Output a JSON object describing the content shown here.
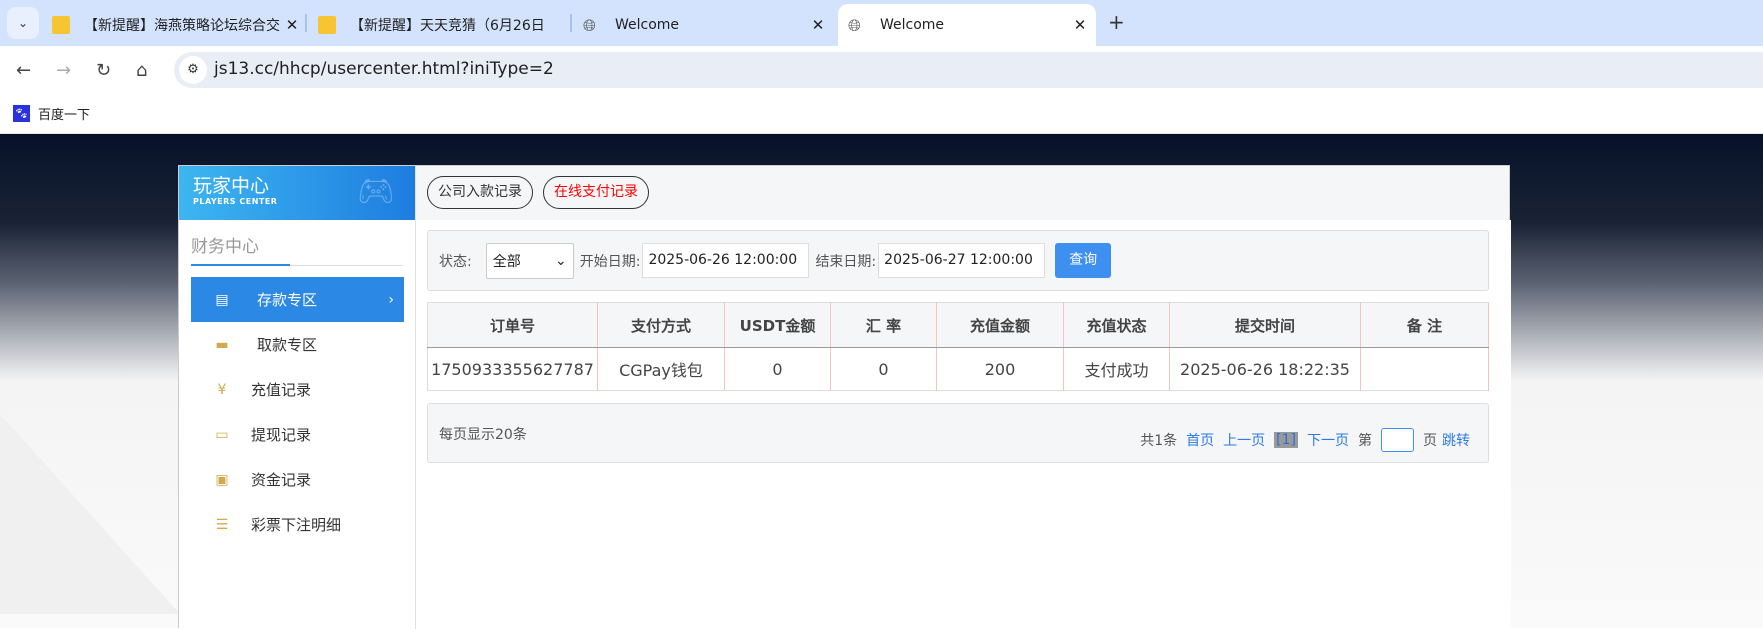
{
  "browser": {
    "tabs": [
      {
        "title": "【新提醒】海燕策略论坛综合交",
        "active": false
      },
      {
        "title": "【新提醒】天天竞猜（6月26日",
        "active": false
      },
      {
        "title": "Welcome",
        "active": false
      },
      {
        "title": "Welcome",
        "active": true
      }
    ],
    "url": "js13.cc/hhcp/usercenter.html?iniType=2",
    "bookmarks": [
      {
        "label": "百度一下"
      }
    ]
  },
  "sidebar": {
    "title": "玩家中心",
    "subtitle": "PLAYERS CENTER",
    "section": "财务中心",
    "items": [
      {
        "label": "存款专区",
        "icon": "card-icon",
        "active": true
      },
      {
        "label": "取款专区",
        "icon": "hand-coin-icon"
      },
      {
        "label": "充值记录",
        "icon": "money-bag-icon"
      },
      {
        "label": "提现记录",
        "icon": "wallet-icon"
      },
      {
        "label": "资金记录",
        "icon": "cash-icon"
      },
      {
        "label": "彩票下注明细",
        "icon": "list-icon"
      }
    ]
  },
  "top_buttons": {
    "company": "公司入款记录",
    "online": "在线支付记录"
  },
  "filter": {
    "status_label": "状态:",
    "status_value": "全部",
    "start_label": "开始日期:",
    "start_value": "2025-06-26 12:00:00",
    "end_label": "结束日期:",
    "end_value": "2025-06-27 12:00:00",
    "query": "查询"
  },
  "table": {
    "headers": [
      "订单号",
      "支付方式",
      "USDT金额",
      "汇 率",
      "充值金额",
      "充值状态",
      "提交时间",
      "备 注"
    ],
    "rows": [
      [
        "1750933355627787",
        "CGPay钱包",
        "0",
        "0",
        "200",
        "支付成功",
        "2025-06-26 18:22:35",
        ""
      ]
    ]
  },
  "pager": {
    "per_page": "每页显示20条",
    "total": "共1条",
    "first": "首页",
    "prev": "上一页",
    "current": "[1]",
    "next": "下一页",
    "page_prefix": "第",
    "page_suffix": "页",
    "jump": "跳转"
  }
}
